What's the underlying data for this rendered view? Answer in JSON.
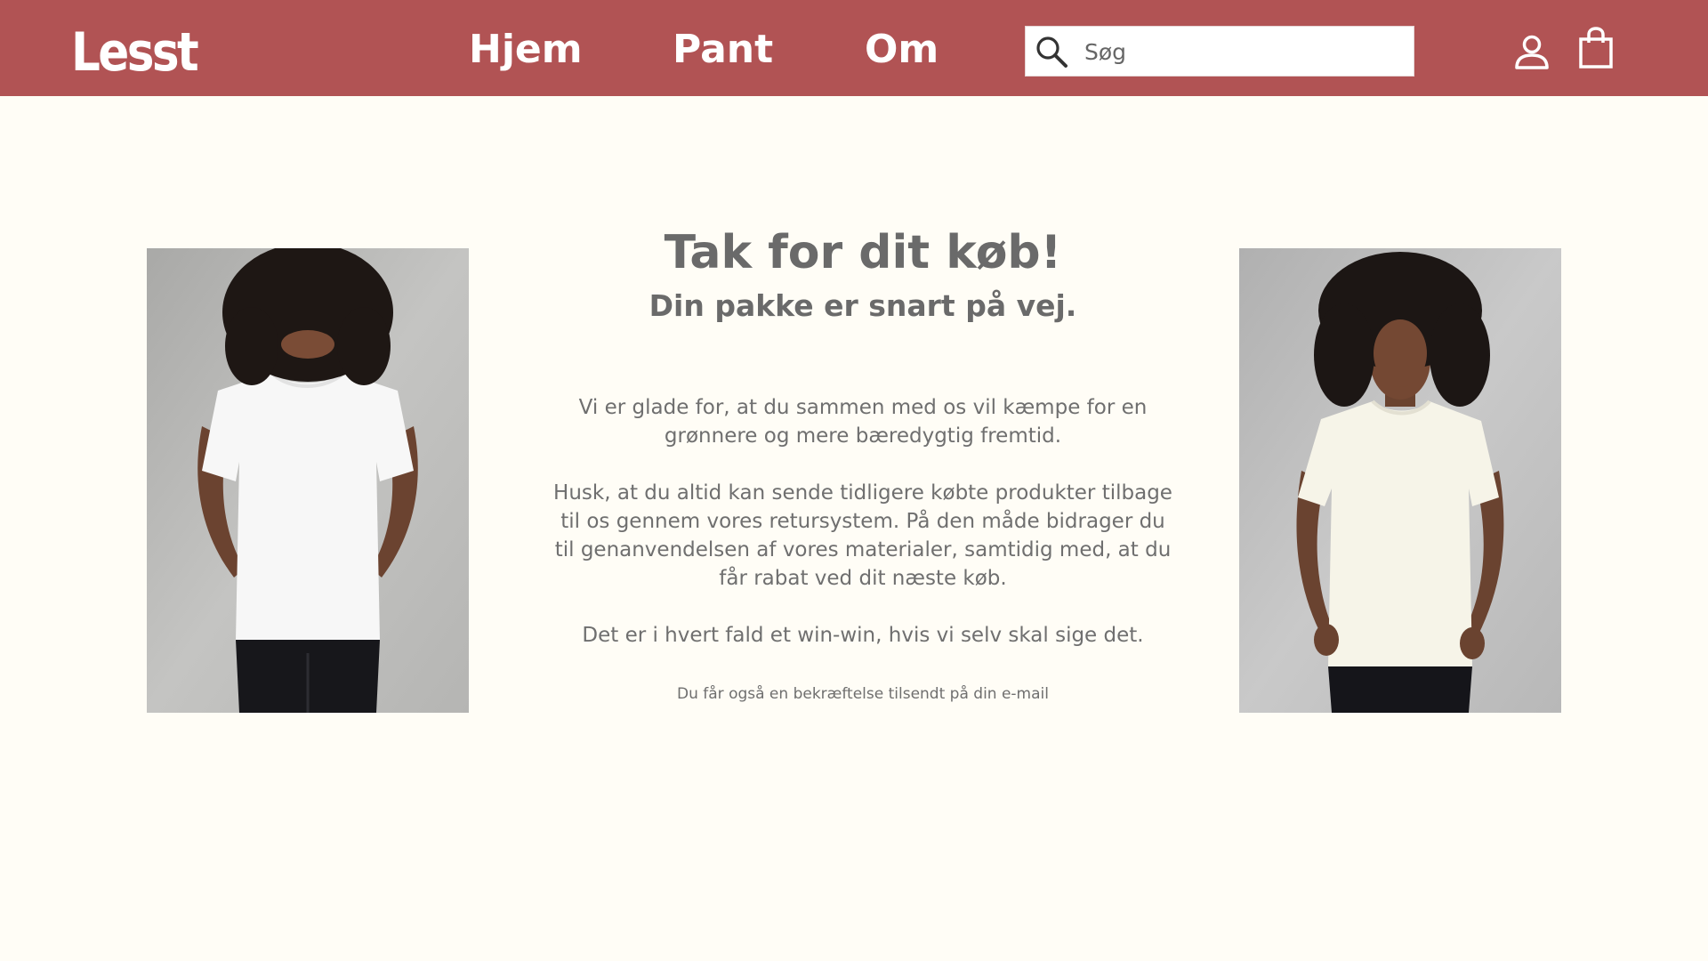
{
  "header": {
    "logo": "Lesst",
    "nav": [
      {
        "label": "Hjem"
      },
      {
        "label": "Pant"
      },
      {
        "label": "Om"
      }
    ],
    "search": {
      "placeholder": "Søg",
      "value": ""
    },
    "icons": [
      "search-icon",
      "account-icon",
      "shopping-bag-icon"
    ]
  },
  "main": {
    "title": "Tak for dit køb!",
    "subtitle": "Din pakke er snart på vej.",
    "paragraphs": [
      "Vi er glade for, at du sammen med os vil kæmpe for en grønnere og mere bæredygtig fremtid.",
      "Husk, at du altid kan sende tidligere købte produkter tilbage til os gennem vores retursystem. På den måde bidrager du til genanvendelsen af vores materialer, samtidig med, at du får rabat ved dit næste køb.",
      "Det er i hvert fald et win-win, hvis vi selv skal sige det."
    ],
    "note": "Du får også en bekræftelse tilsendt på din e-mail"
  },
  "colors": {
    "header_bg": "#b15354",
    "page_bg": "#fffdf6",
    "text": "#6b6b6b"
  }
}
